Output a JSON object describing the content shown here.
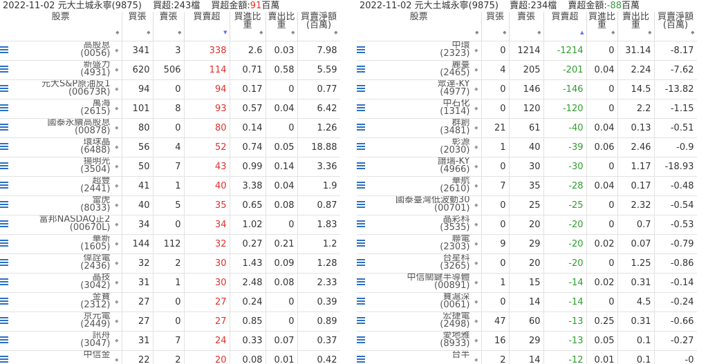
{
  "left": {
    "title": {
      "date_broker": "2022-11-02 元大土城永寧(9875)",
      "stat": "買超:243檔",
      "amount_label": "買超金額:",
      "amount_value": "91",
      "amount_unit": "百萬"
    },
    "headers": [
      "股票",
      "買張",
      "賣張",
      "買賣超",
      "買進比重",
      "賣出比重",
      "買賣淨額(百萬)"
    ],
    "rows": [
      {
        "name": "高股息",
        "code": "(0056)",
        "buy": "341",
        "sell": "3",
        "net": "338",
        "buy_pct": "2.6",
        "sell_pct": "0.03",
        "amt": "7.98"
      },
      {
        "name": "新盛力",
        "code": "(4931)",
        "buy": "620",
        "sell": "506",
        "net": "114",
        "buy_pct": "0.71",
        "sell_pct": "0.58",
        "amt": "5.59"
      },
      {
        "name": "元大S&P原油反1",
        "code": "(00673R)",
        "buy": "94",
        "sell": "0",
        "net": "94",
        "buy_pct": "0.17",
        "sell_pct": "0",
        "amt": "0.77"
      },
      {
        "name": "萬海",
        "code": "(2615)",
        "buy": "101",
        "sell": "8",
        "net": "93",
        "buy_pct": "0.57",
        "sell_pct": "0.04",
        "amt": "6.42"
      },
      {
        "name": "國泰永續高股息",
        "code": "(00878)",
        "buy": "80",
        "sell": "0",
        "net": "80",
        "buy_pct": "0.14",
        "sell_pct": "0",
        "amt": "1.26"
      },
      {
        "name": "環球晶",
        "code": "(6488)",
        "buy": "56",
        "sell": "4",
        "net": "52",
        "buy_pct": "0.74",
        "sell_pct": "0.05",
        "amt": "18.88"
      },
      {
        "name": "揚明光",
        "code": "(3504)",
        "buy": "50",
        "sell": "7",
        "net": "43",
        "buy_pct": "0.99",
        "sell_pct": "0.14",
        "amt": "3.36"
      },
      {
        "name": "超豐",
        "code": "(2441)",
        "buy": "41",
        "sell": "1",
        "net": "40",
        "buy_pct": "3.38",
        "sell_pct": "0.04",
        "amt": "1.9"
      },
      {
        "name": "雷虎",
        "code": "(8033)",
        "buy": "40",
        "sell": "5",
        "net": "35",
        "buy_pct": "0.65",
        "sell_pct": "0.08",
        "amt": "0.87"
      },
      {
        "name": "富邦NASDAQ正2",
        "code": "(00670L)",
        "buy": "34",
        "sell": "0",
        "net": "34",
        "buy_pct": "1.02",
        "sell_pct": "0",
        "amt": "1.83"
      },
      {
        "name": "華新",
        "code": "(1605)",
        "buy": "144",
        "sell": "112",
        "net": "32",
        "buy_pct": "0.27",
        "sell_pct": "0.21",
        "amt": "1.2"
      },
      {
        "name": "偉詮電",
        "code": "(2436)",
        "buy": "32",
        "sell": "2",
        "net": "30",
        "buy_pct": "1.43",
        "sell_pct": "0.09",
        "amt": "1.28"
      },
      {
        "name": "晶技",
        "code": "(3042)",
        "buy": "31",
        "sell": "1",
        "net": "30",
        "buy_pct": "2.48",
        "sell_pct": "0.08",
        "amt": "2.33"
      },
      {
        "name": "金寶",
        "code": "(2312)",
        "buy": "27",
        "sell": "0",
        "net": "27",
        "buy_pct": "0.24",
        "sell_pct": "0",
        "amt": "0.39"
      },
      {
        "name": "京元電",
        "code": "(2449)",
        "buy": "27",
        "sell": "0",
        "net": "27",
        "buy_pct": "0.85",
        "sell_pct": "0",
        "amt": "0.89"
      },
      {
        "name": "訊舟",
        "code": "(3047)",
        "buy": "31",
        "sell": "7",
        "net": "24",
        "buy_pct": "0.33",
        "sell_pct": "0.07",
        "amt": "0.37"
      },
      {
        "name": "中信金",
        "code": "",
        "buy": "22",
        "sell": "2",
        "net": "20",
        "buy_pct": "0.08",
        "sell_pct": "0.01",
        "amt": "0.42"
      }
    ]
  },
  "right": {
    "title": {
      "date_broker": "2022-11-02 元大土城永寧(9875)",
      "stat": "賣超:234檔",
      "amount_label": "賣超金額:",
      "amount_value": "-88",
      "amount_unit": "百萬"
    },
    "headers": [
      "股票",
      "買張",
      "賣張",
      "買賣超",
      "買進比重",
      "賣出比重",
      "買賣淨額(百萬)"
    ],
    "rows": [
      {
        "name": "中環",
        "code": "(2323)",
        "buy": "0",
        "sell": "1214",
        "net": "-1214",
        "buy_pct": "0",
        "sell_pct": "31.14",
        "amt": "-8.17"
      },
      {
        "name": "麗臺",
        "code": "(2465)",
        "buy": "4",
        "sell": "205",
        "net": "-201",
        "buy_pct": "0.04",
        "sell_pct": "2.24",
        "amt": "-7.62"
      },
      {
        "name": "眾達-KY",
        "code": "(4977)",
        "buy": "0",
        "sell": "146",
        "net": "-146",
        "buy_pct": "0",
        "sell_pct": "14.5",
        "amt": "-13.82"
      },
      {
        "name": "中石化",
        "code": "(1314)",
        "buy": "0",
        "sell": "120",
        "net": "-120",
        "buy_pct": "0",
        "sell_pct": "2.2",
        "amt": "-1.15"
      },
      {
        "name": "群創",
        "code": "(3481)",
        "buy": "21",
        "sell": "61",
        "net": "-40",
        "buy_pct": "0.04",
        "sell_pct": "0.13",
        "amt": "-0.51"
      },
      {
        "name": "彰源",
        "code": "(2030)",
        "buy": "1",
        "sell": "40",
        "net": "-39",
        "buy_pct": "0.06",
        "sell_pct": "2.46",
        "amt": "-0.9"
      },
      {
        "name": "譜瑞-KY",
        "code": "(4966)",
        "buy": "0",
        "sell": "30",
        "net": "-30",
        "buy_pct": "0",
        "sell_pct": "1.17",
        "amt": "-18.93"
      },
      {
        "name": "華航",
        "code": "(2610)",
        "buy": "7",
        "sell": "35",
        "net": "-28",
        "buy_pct": "0.04",
        "sell_pct": "0.17",
        "amt": "-0.48"
      },
      {
        "name": "國泰臺灣低波動30",
        "code": "(00701)",
        "buy": "0",
        "sell": "25",
        "net": "-25",
        "buy_pct": "0",
        "sell_pct": "2.32",
        "amt": "-0.54"
      },
      {
        "name": "晶彩科",
        "code": "(3535)",
        "buy": "0",
        "sell": "20",
        "net": "-20",
        "buy_pct": "0",
        "sell_pct": "0.7",
        "amt": "-0.53"
      },
      {
        "name": "聯電",
        "code": "(2303)",
        "buy": "9",
        "sell": "29",
        "net": "-20",
        "buy_pct": "0.02",
        "sell_pct": "0.07",
        "amt": "-0.79"
      },
      {
        "name": "台星科",
        "code": "(3265)",
        "buy": "0",
        "sell": "20",
        "net": "-20",
        "buy_pct": "0",
        "sell_pct": "1.25",
        "amt": "-0.86"
      },
      {
        "name": "中信關鍵半導體",
        "code": "(00891)",
        "buy": "1",
        "sell": "15",
        "net": "-14",
        "buy_pct": "0.02",
        "sell_pct": "0.31",
        "amt": "-0.14"
      },
      {
        "name": "寶滬深",
        "code": "(0061)",
        "buy": "0",
        "sell": "14",
        "net": "-14",
        "buy_pct": "0",
        "sell_pct": "4.5",
        "amt": "-0.24"
      },
      {
        "name": "宏捷電",
        "code": "(2498)",
        "buy": "47",
        "sell": "60",
        "net": "-13",
        "buy_pct": "0.25",
        "sell_pct": "0.31",
        "amt": "-0.66"
      },
      {
        "name": "愛地雅",
        "code": "(8933)",
        "buy": "16",
        "sell": "29",
        "net": "-13",
        "buy_pct": "0.05",
        "sell_pct": "0.1",
        "amt": "-0.27"
      },
      {
        "name": "台半",
        "code": "",
        "buy": "2",
        "sell": "14",
        "net": "-12",
        "buy_pct": "0.01",
        "sell_pct": "0.1",
        "amt": "-0"
      }
    ]
  },
  "icons": {
    "row_icon": "list-icon",
    "sort_icon": "sort-arrows-icon"
  },
  "colors": {
    "buy": "#e0302a",
    "sell": "#2e9e2e",
    "icon": "#2a6fc4"
  }
}
